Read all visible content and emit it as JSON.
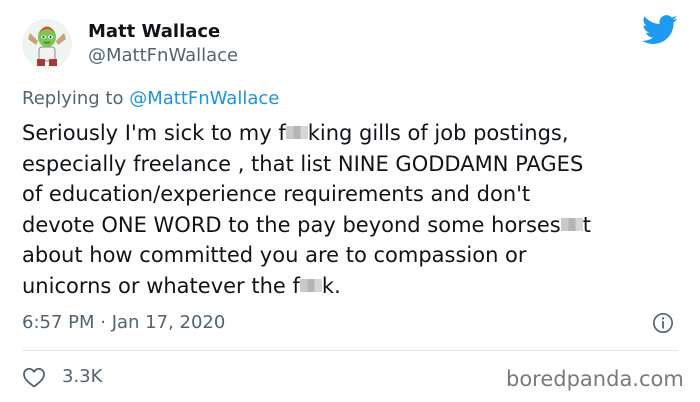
{
  "tweet": {
    "author_name": "Matt Wallace",
    "author_handle": "@MattFnWallace",
    "reply_prefix": "Replying to ",
    "reply_mention": "@MattFnWallace",
    "lines": [
      [
        "Seriously I'm sick to my f",
        "king gills of job postings,"
      ],
      [
        "especially freelance , that list NINE GODDAMN PAGES"
      ],
      [
        "of education/experience requirements and don't"
      ],
      [
        "devote ONE WORD to the pay beyond some horses",
        "t"
      ],
      [
        "about how committed you are to compassion or"
      ],
      [
        "unicorns or whatever the f",
        "k."
      ]
    ],
    "timestamp": "6:57 PM · Jan 17, 2020",
    "like_count": "3.3K"
  },
  "watermark": "boredpanda.com",
  "colors": {
    "twitter_blue": "#1d9bf0",
    "secondary_text": "#536471",
    "text": "#0f1419"
  },
  "icons": {
    "logo": "twitter-bird-icon",
    "info": "info-icon",
    "like": "heart-icon"
  }
}
